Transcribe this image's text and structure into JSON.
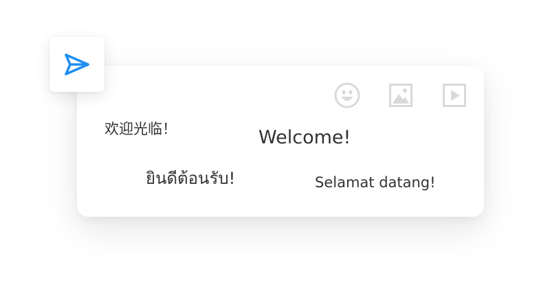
{
  "colors": {
    "accent": "#1f8ef1",
    "icon_muted": "#d9d9d9",
    "text": "#333333"
  },
  "send_button": {
    "icon": "send-icon"
  },
  "toolbar": {
    "emoji": {
      "icon": "emoji-icon"
    },
    "image": {
      "icon": "image-icon"
    },
    "video": {
      "icon": "video-play-icon"
    }
  },
  "greetings": {
    "chinese": "欢迎光临！",
    "english": "Welcome!",
    "thai": "ยินดีต้อนรับ!",
    "indonesian": "Selamat datang!"
  }
}
